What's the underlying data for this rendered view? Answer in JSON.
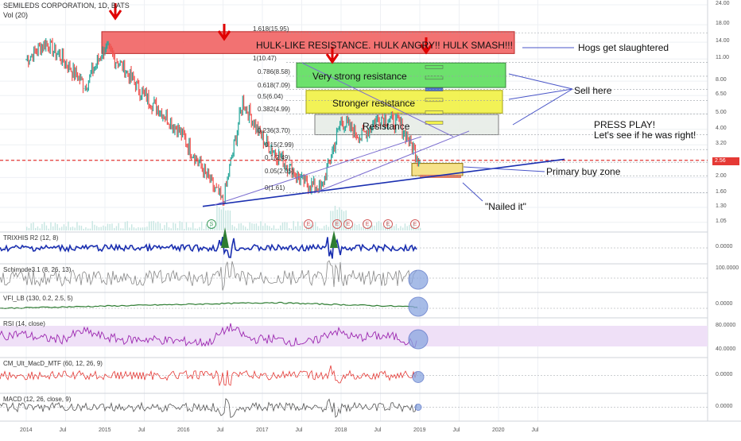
{
  "header": {
    "symbol_line": "SEMILEDS CORPORATION, 1D, BATS",
    "volume_label": "Vol (20)"
  },
  "price_axis": {
    "ticks": [
      "24.00",
      "18.00",
      "14.00",
      "11.00",
      "8.00",
      "6.50",
      "5.00",
      "4.00",
      "3.20",
      "2.56",
      "2.00",
      "1.60",
      "1.30",
      "1.05"
    ],
    "current_price": "2.56"
  },
  "time_axis": {
    "ticks": [
      "2014",
      "Jul",
      "2015",
      "Jul",
      "2016",
      "Jul",
      "2017",
      "Jul",
      "2018",
      "Jul",
      "2019",
      "Jul",
      "2020",
      "Jul"
    ]
  },
  "fib_levels": [
    "1.618(15.95)",
    "1(10.47)",
    "0.786(8.58)",
    "0.618(7.09)",
    "0.5(6.04)",
    "0.382(4.99)",
    "0.236(3.70)",
    "0.15(2.99)",
    "0.1(2.49)",
    "0.05(2.05)",
    "0(1.61)"
  ],
  "annotations": {
    "hulk": "HULK-LIKE RESISTANCE. HULK ANGRY!! HULK SMASH!!!",
    "hogs": "Hogs get slaughtered",
    "very_strong": "Very strong resistance",
    "stronger": "Stronger resistance",
    "resistance": "Resistance",
    "sell": "Sell here",
    "press_play": "PRESS PLAY!",
    "lets_see": "Let's see if he was right!",
    "primary_buy": "Primary buy zone",
    "nailed": "\"Nailed it\""
  },
  "event_markers": [
    "S",
    "E",
    "E",
    "E",
    "E",
    "E",
    "E"
  ],
  "indicators": [
    {
      "title": "TRIXHIS R2 (12, 8)",
      "ticks": [
        "0.0000"
      ]
    },
    {
      "title": "Schimode3.1 (8, 26, 13)",
      "ticks": [
        "100.0000"
      ]
    },
    {
      "title": "VFI_LB (130, 0.2, 2.5, 5)",
      "ticks": [
        "0.0000"
      ]
    },
    {
      "title": "RSI (14, close)",
      "ticks": [
        "80.0000",
        "40.0000"
      ]
    },
    {
      "title": "CM_Ult_MacD_MTF (60, 12, 26, 9)",
      "ticks": [
        "0.0000"
      ]
    },
    {
      "title": "MACD (12, 26, close, 9)",
      "ticks": [
        "0.0000"
      ]
    }
  ],
  "colors": {
    "hulk_zone": "#f26b6b",
    "very_strong_zone": "#66e066",
    "stronger_zone": "#f2f24d",
    "resistance_zone": "#e8eee8",
    "buy_zone": "#f6e28a",
    "trendline": "#1a2fb0",
    "current_price_line": "#e53935",
    "candle_up": "#26a69a",
    "candle_down": "#ef5350",
    "rsi_line": "#9c27b0",
    "vfi_line": "#2e7d32",
    "event_circle": "#d35d5d",
    "split_circle": "#3e9e5e",
    "arrow": "#e00000"
  },
  "chart_data": [
    {
      "type": "line",
      "title": "SEMILEDS CORPORATION, 1D, BATS",
      "scale": "log",
      "ylim": [
        1.0,
        24.0
      ],
      "x": [
        "2014-01",
        "2014-04",
        "2014-07",
        "2014-10",
        "2015-01",
        "2015-04",
        "2015-07",
        "2015-10",
        "2016-01",
        "2016-04",
        "2016-07",
        "2016-10",
        "2017-01",
        "2017-04",
        "2017-07",
        "2017-10",
        "2018-01",
        "2018-04",
        "2018-07",
        "2018-10",
        "2019-01"
      ],
      "series": [
        {
          "name": "",
          "values": [
            11.0,
            14.0,
            10.5,
            7.5,
            13.0,
            9.5,
            6.5,
            5.0,
            3.6,
            2.2,
            1.4,
            6.0,
            3.5,
            2.6,
            1.9,
            1.7,
            4.5,
            3.6,
            4.8,
            4.3,
            2.56
          ]
        }
      ]
    },
    {
      "type": "line",
      "title": "RSI (14, close)",
      "ylim": [
        0,
        100
      ],
      "series": [
        {
          "name": "",
          "values": [
            55,
            62,
            48,
            45,
            70,
            52,
            43,
            46,
            42,
            38,
            35,
            82,
            45,
            47,
            38,
            36,
            72,
            50,
            55,
            52,
            28
          ]
        }
      ]
    }
  ]
}
